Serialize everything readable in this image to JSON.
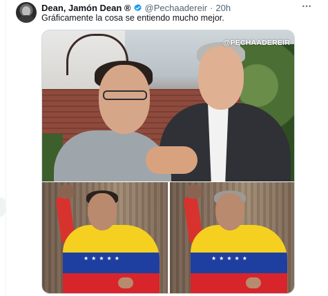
{
  "tweet": {
    "author_name": "Dean, Jamón Dean ®",
    "handle": "@Pechaadereir",
    "separator": "·",
    "time": "20h",
    "text": "Gráficamente la cosa se entiendo mucho mejor.",
    "more_icon": "more-horizontal-icon",
    "verified_icon": "verified-badge-icon",
    "verified_color": "#1d9bf0"
  },
  "media": {
    "watermark": "@PECHAADEREIR"
  },
  "colors": {
    "text_primary": "#0f1419",
    "text_secondary": "#536471",
    "border": "#cfd9de"
  }
}
